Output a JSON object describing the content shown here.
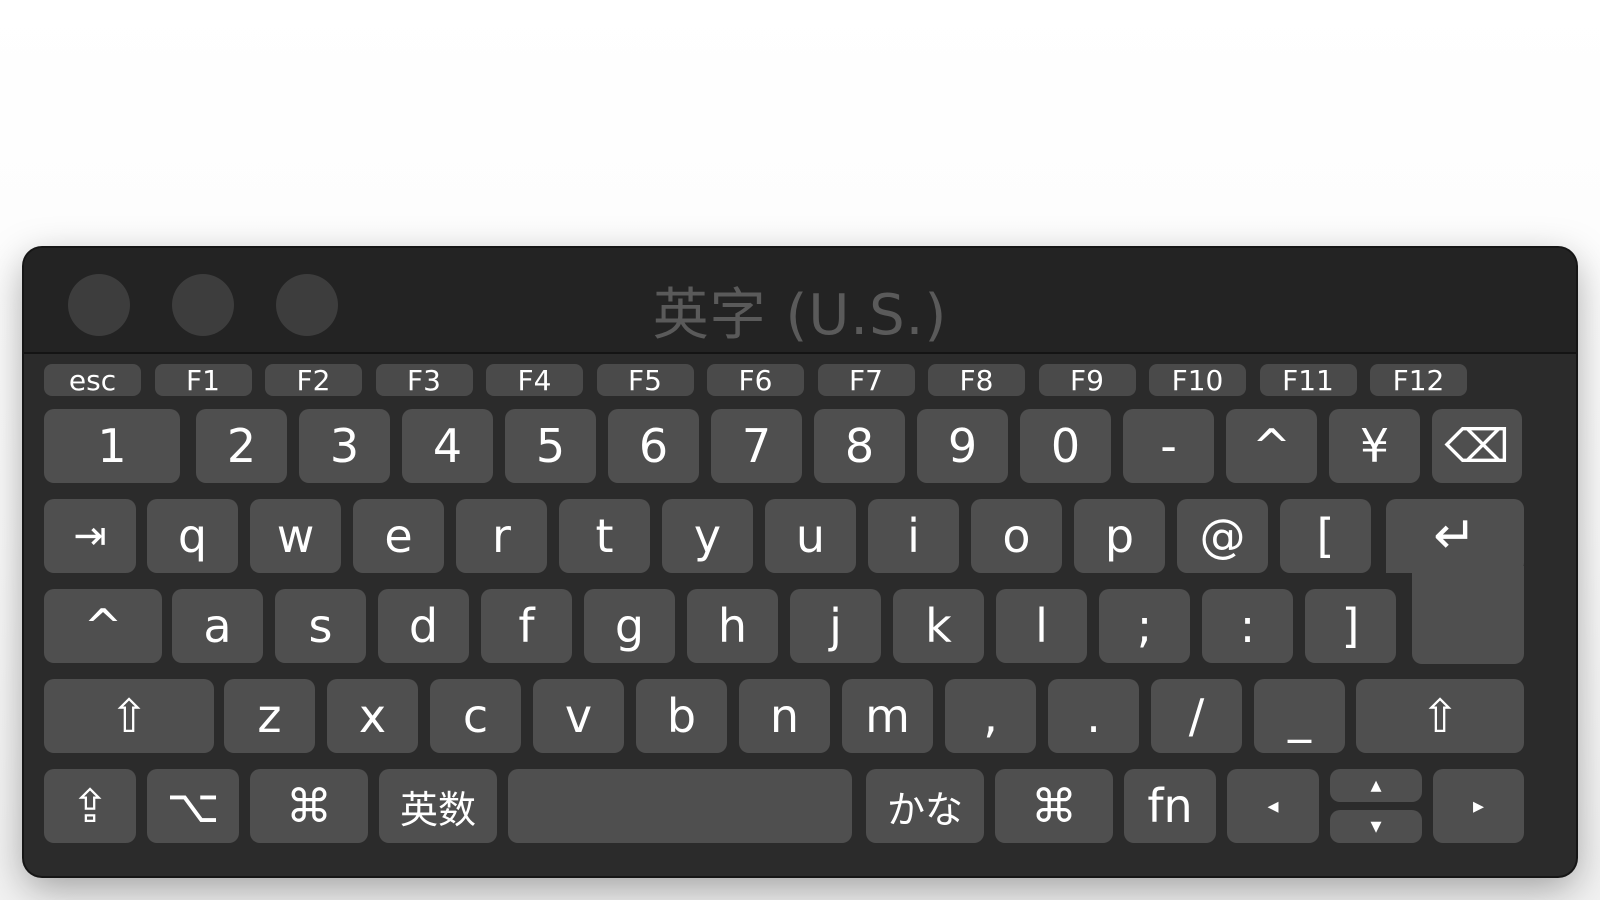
{
  "window": {
    "title": "英字 (U.S.)",
    "traffic_lights": [
      "close-button",
      "minimize-button",
      "zoom-button"
    ]
  },
  "rows": {
    "function": [
      "esc",
      "F1",
      "F2",
      "F3",
      "F4",
      "F5",
      "F6",
      "F7",
      "F8",
      "F9",
      "F10",
      "F11",
      "F12"
    ],
    "number": [
      "1",
      "2",
      "3",
      "4",
      "5",
      "6",
      "7",
      "8",
      "9",
      "0",
      "-",
      "^",
      "¥",
      "⌫"
    ],
    "top": [
      "⇥",
      "q",
      "w",
      "e",
      "r",
      "t",
      "y",
      "u",
      "i",
      "o",
      "p",
      "@",
      "[",
      "↵"
    ],
    "home": [
      "^",
      "a",
      "s",
      "d",
      "f",
      "g",
      "h",
      "j",
      "k",
      "l",
      ";",
      ":",
      "]"
    ],
    "bottom": [
      "⇧",
      "z",
      "x",
      "c",
      "v",
      "b",
      "n",
      "m",
      ",",
      ".",
      "/",
      "_",
      "⇧"
    ],
    "modifier": [
      "⇪",
      "⌥",
      "⌘",
      "英数",
      "",
      "かな",
      "⌘",
      "fn",
      "◂",
      "▴",
      "▾",
      "▸"
    ]
  }
}
